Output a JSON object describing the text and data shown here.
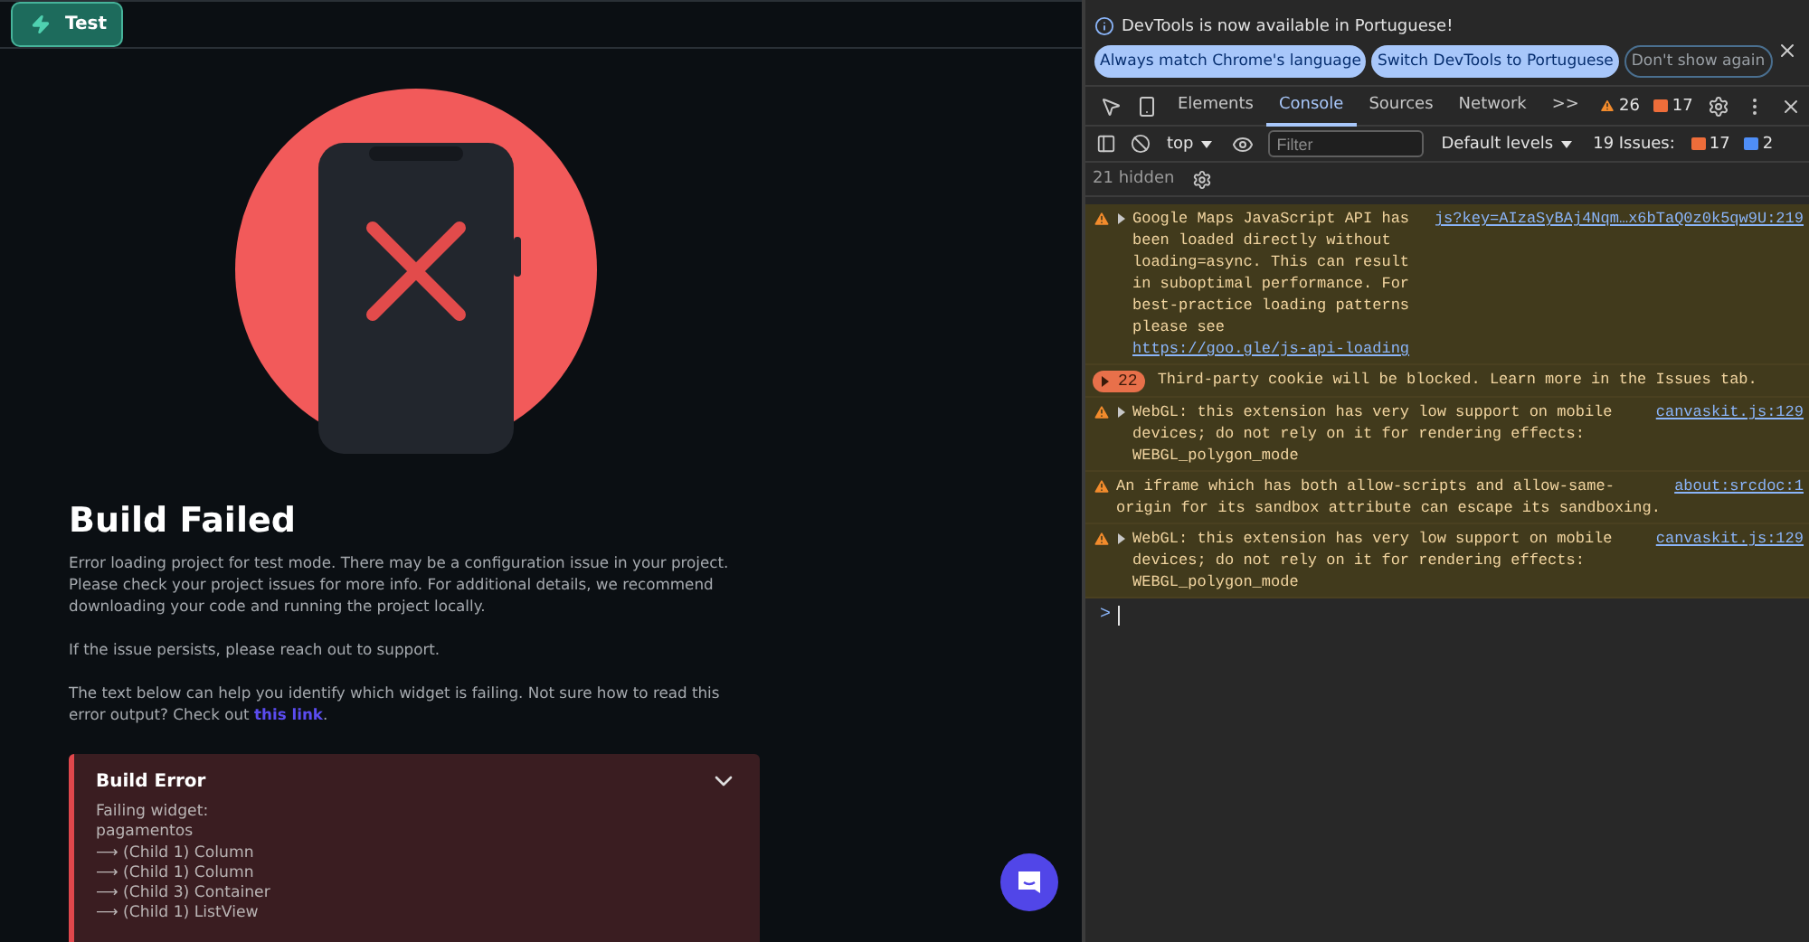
{
  "app": {
    "test_button": "Test",
    "title": "Build Failed",
    "paragraphs": [
      "Error loading project for test mode. There may be a configuration issue in your project. Please check your project issues for more info. For additional details, we recommend downloading your code and running the project locally.",
      "If the issue persists, please reach out to support."
    ],
    "help": {
      "text": "The text below can help you identify which widget is failing. Not sure how to read this error output? Check out ",
      "link": "this link",
      "after": "."
    },
    "error_box": {
      "title": "Build Error",
      "expanded": true,
      "lines": [
        "Failing widget:",
        "pagamentos",
        "⟶ (Child 1) Column",
        "⟶ (Child 1) Column",
        "⟶ (Child 3) Container",
        "⟶ (Child 1) ListView"
      ]
    }
  },
  "devtools": {
    "banner": {
      "text": "DevTools is now available in Portuguese!",
      "buttons": [
        {
          "label": "Always match Chrome's language",
          "kind": "filled"
        },
        {
          "label": "Switch DevTools to Portuguese",
          "kind": "filled"
        },
        {
          "label": "Don't show again",
          "kind": "outline"
        }
      ]
    },
    "tabs": [
      {
        "label": "Elements",
        "selected": false
      },
      {
        "label": "Console",
        "selected": true
      },
      {
        "label": "Sources",
        "selected": false
      },
      {
        "label": "Network",
        "selected": false
      }
    ],
    "more": ">>",
    "warnings": "26",
    "errors": "17",
    "toolbar": {
      "context": "top",
      "filter_placeholder": "Filter",
      "levels": "Default levels",
      "issues_label": "19 Issues:",
      "issues_errors": "17",
      "issues_info": "2"
    },
    "hidden": "21 hidden",
    "messages": [
      {
        "kind": "warning",
        "expandable": true,
        "source": "js?key=AIzaSyBAj4Nqm…x6bTaQ0z0k5qw9U:219",
        "text": "Google Maps JavaScript API has been loaded directly without loading=async. This can result in suboptimal performance. For best-practice loading patterns please see ",
        "link": "https://goo.gle/js-api-loading"
      },
      {
        "kind": "group",
        "count": "22",
        "text": "Third-party cookie will be blocked. Learn more in the Issues tab."
      },
      {
        "kind": "warning",
        "expandable": true,
        "source": "canvaskit.js:129",
        "text": "WebGL: this extension has very low support on mobile devices; do not rely on it for rendering effects: WEBGL_polygon_mode"
      },
      {
        "kind": "warning",
        "expandable": false,
        "source": "about:srcdoc:1",
        "text": "An iframe which has both allow-scripts and allow-same-origin for its sandbox attribute can escape its sandboxing."
      },
      {
        "kind": "warning",
        "expandable": true,
        "source": "canvaskit.js:129",
        "text": "WebGL: this extension has very low support on mobile devices; do not rely on it for rendering effects: WEBGL_polygon_mode"
      }
    ],
    "prompt": ">"
  }
}
